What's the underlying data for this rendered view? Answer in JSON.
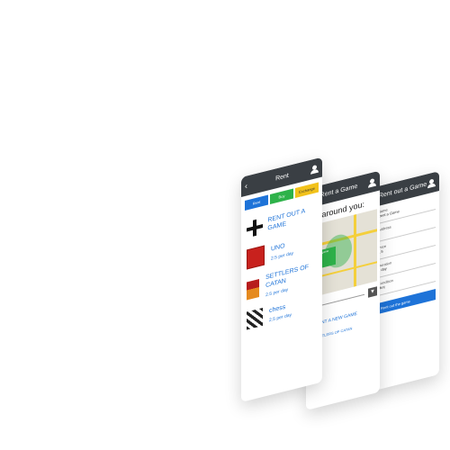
{
  "screen1": {
    "title": "Rent",
    "back": "‹",
    "tabs": [
      "Rent",
      "Buy",
      "Exchange"
    ],
    "rent_label": "RENT OUT A GAME",
    "games": [
      {
        "name": "UNO",
        "price": "2.5 per day"
      },
      {
        "name": "SETTLERS OF CATAN",
        "price": "2.5 per day"
      },
      {
        "name": "chess",
        "price": "2.5 per day"
      }
    ]
  },
  "screen2": {
    "title": "Rent a Game",
    "heading": "ing around you:",
    "map_tip": "Rent a game nearby",
    "link": "RENT A NEW GAME",
    "bottom_link": "SETTLERS OF CATAN"
  },
  "screen3": {
    "title": "Rent out a Game",
    "fields": [
      {
        "label": "Name",
        "value": "Rent a Game"
      },
      {
        "label": "Address",
        "value": ""
      },
      {
        "label": "Price",
        "value": "2.5"
      },
      {
        "label": "Duration",
        "value": "1 day"
      },
      {
        "label": "Condition",
        "value": "Mint"
      }
    ],
    "submit": "Rent out the game"
  }
}
